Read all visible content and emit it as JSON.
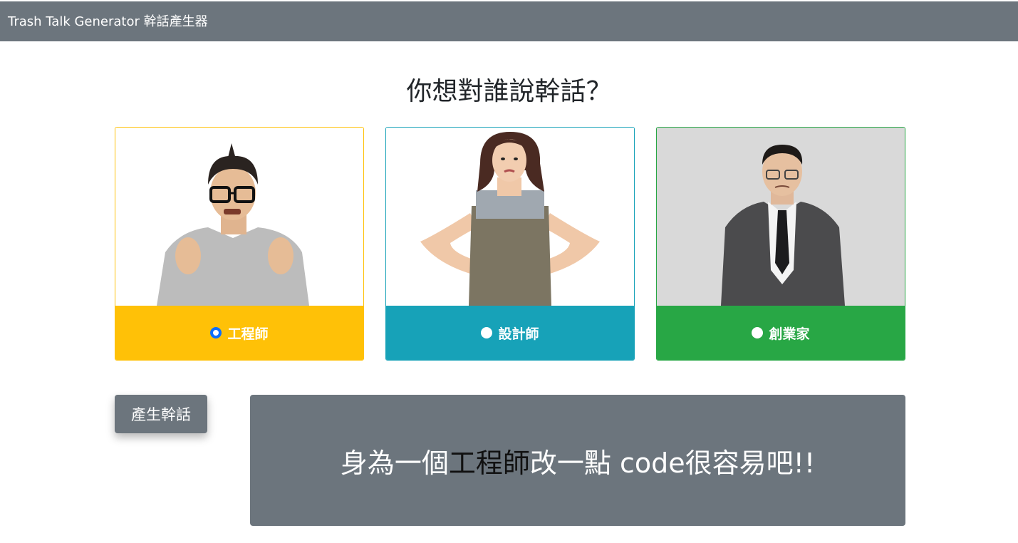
{
  "navbar": {
    "brand": "Trash Talk Generator 幹話產生器"
  },
  "heading": "你想對誰說幹話？",
  "options": [
    {
      "label": "工程師",
      "checked": true,
      "color": "#ffc107",
      "icon": "engineer-photo"
    },
    {
      "label": "設計師",
      "checked": false,
      "color": "#17a2b8",
      "icon": "designer-photo"
    },
    {
      "label": "創業家",
      "checked": false,
      "color": "#28a745",
      "icon": "entrepreneur-photo"
    }
  ],
  "generate_button": {
    "label": "產生幹話"
  },
  "result": {
    "prefix": "身為一個",
    "target": "工程師",
    "suffix": "改一點 code很容易吧!!"
  },
  "colors": {
    "navbar": "#6c757d",
    "radio_checked": "#0d6efd",
    "result_bg": "#6c757d"
  }
}
